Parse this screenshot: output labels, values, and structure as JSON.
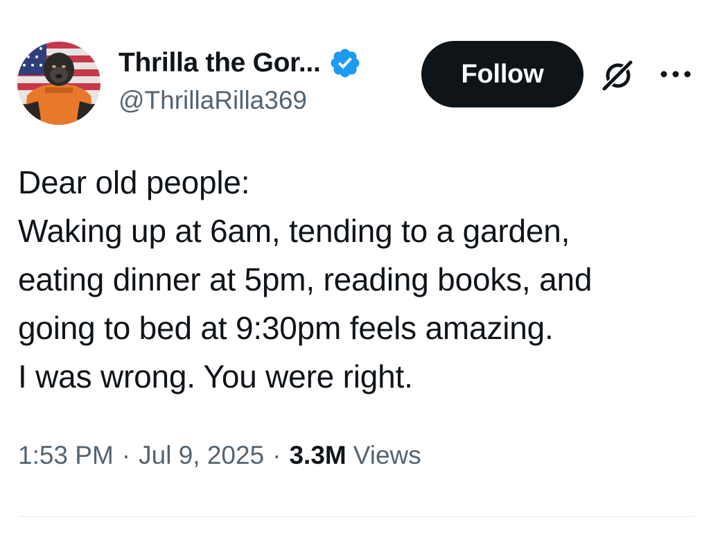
{
  "author": {
    "display_name": "Thrilla the Gor...",
    "handle": "@ThrillaRilla369",
    "verified": true,
    "verified_color": "#1d9bf0",
    "avatar": "gorilla-avatar"
  },
  "actions": {
    "follow_label": "Follow",
    "grok_icon": "grok-icon",
    "more_icon": "more-icon"
  },
  "tweet": {
    "lines": [
      "Dear old people:",
      "Waking up at 6am, tending to a garden,",
      "eating dinner at 5pm, reading books, and",
      "going to bed at 9:30pm feels amazing.",
      "I was wrong. You were right."
    ]
  },
  "meta": {
    "time": "1:53 PM",
    "separator": "·",
    "date": "Jul 9, 2025",
    "views_count": "3.3M",
    "views_label": "Views"
  },
  "colors": {
    "text": "#0f1419",
    "secondary": "#536471",
    "follow_bg": "#0f1419",
    "divider": "#eff3f4"
  }
}
